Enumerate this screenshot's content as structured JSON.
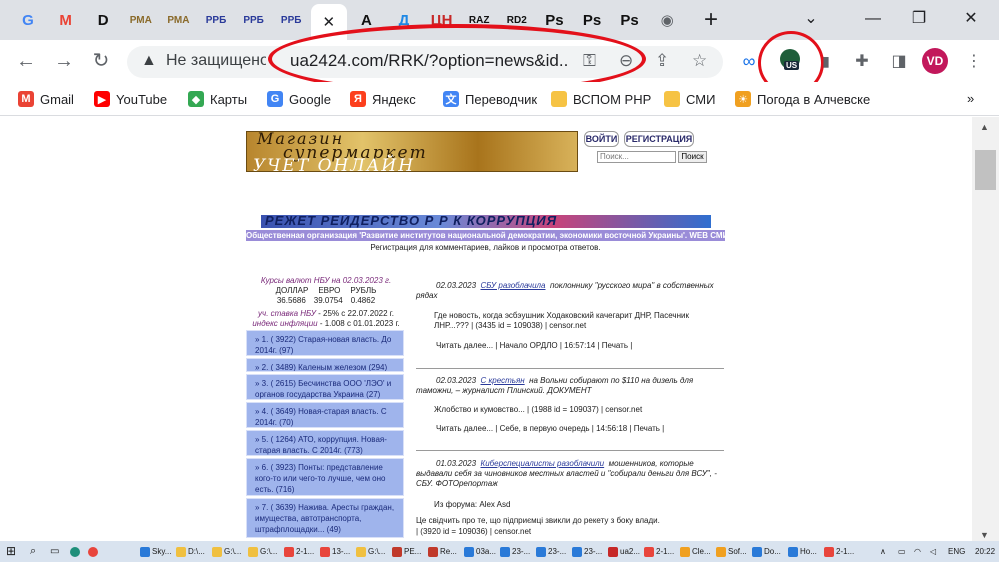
{
  "browser": {
    "tabs": [
      {
        "label": "G",
        "icon": "google-icon",
        "color": "#4285f4"
      },
      {
        "label": "M",
        "icon": "gmail-icon",
        "color": "#ea4335"
      },
      {
        "label": "D",
        "icon": "d-icon",
        "color": "#111111"
      },
      {
        "label": "РМА",
        "icon": "pma-icon",
        "color": "#8a6a2a"
      },
      {
        "label": "РМА",
        "icon": "pma-icon",
        "color": "#8a6a2a"
      },
      {
        "label": "РРБ",
        "icon": "rrb-icon",
        "color": "#2a3a9a"
      },
      {
        "label": "РРБ",
        "icon": "rrb-icon",
        "color": "#2a3a9a"
      },
      {
        "label": "РРБ",
        "icon": "rrb-icon",
        "color": "#2a3a9a"
      },
      {
        "label": "✕",
        "icon": "close-icon",
        "color": "#202124",
        "active": true
      },
      {
        "label": "A",
        "icon": "a-icon",
        "color": "#111111"
      },
      {
        "label": "Д",
        "icon": "d-cyr-icon",
        "color": "#1e88e5"
      },
      {
        "label": "ЦН",
        "icon": "cn-icon",
        "color": "#c62828"
      },
      {
        "label": "RAZ",
        "icon": "raz-icon",
        "color": "#111111"
      },
      {
        "label": "RD2",
        "icon": "rd2-icon",
        "color": "#111111"
      },
      {
        "label": "Ps",
        "icon": "ps-icon",
        "color": "#111111"
      },
      {
        "label": "Ps",
        "icon": "ps-icon",
        "color": "#111111"
      },
      {
        "label": "Ps",
        "icon": "ps-icon",
        "color": "#111111"
      },
      {
        "label": "◉",
        "icon": "globe-icon",
        "color": "#5f6368"
      }
    ],
    "new_tab": "+",
    "window_buttons": {
      "dropdown": "⌄",
      "minimize": "—",
      "restore": "❐",
      "close": "✕"
    },
    "nav": {
      "back": "←",
      "forward": "→",
      "reload": "↻"
    },
    "address": {
      "warning_icon": "▲",
      "status": "Не защищено",
      "url": "ua2424.com/RRK/?option=news&id..."
    },
    "extension_badge": "US",
    "profile_initials": "VD",
    "bookmarks": [
      {
        "label": "Gmail",
        "icon": "gmail-icon",
        "color": "#ea4335",
        "glyph": "M"
      },
      {
        "label": "YouTube",
        "icon": "youtube-icon",
        "color": "#ff0000",
        "glyph": "▶"
      },
      {
        "label": "Карты",
        "icon": "maps-icon",
        "color": "#34a853",
        "glyph": "◆"
      },
      {
        "label": "Google",
        "icon": "google-icon",
        "color": "#4285f4",
        "glyph": "G"
      },
      {
        "label": "Яндекс",
        "icon": "yandex-icon",
        "color": "#fc3f1d",
        "glyph": "Я"
      },
      {
        "label": "Переводчик",
        "icon": "translate-icon",
        "color": "#4285f4",
        "glyph": "文"
      },
      {
        "label": "ВСПОМ PHP",
        "icon": "folder-icon",
        "color": "#f6c344",
        "glyph": ""
      },
      {
        "label": "СМИ",
        "icon": "folder-icon",
        "color": "#f6c344",
        "glyph": ""
      },
      {
        "label": "Погода в Алчевске",
        "icon": "weather-icon",
        "color": "#f0a020",
        "glyph": "☀"
      }
    ],
    "bookmarks_more": "»"
  },
  "site": {
    "banner_lines": [
      "Магазин",
      "супермаркет",
      "УЧЕТ ОНЛАЙН"
    ],
    "login": "ВОЙТИ",
    "register": "РЕГИСТРАЦИЯ",
    "search_placeholder": "Поиск...",
    "search_button": "Поиск",
    "rrk_banner": "РЕЖЕТ РЕЙДЕРСТВО  Р Р К  КОРРУПЦИЯ",
    "org_line": "Общественная организация 'Развитие институтов национальной демократии, экономики восточной Украины'. WEB СМИ",
    "reg_line": "Регистрация для комментариев, лайков и просмотра ответов.",
    "rates": {
      "title": "Курсы валют НБУ на 02.03.2023 г.",
      "headers": [
        "ДОЛЛАР",
        "ЕВРО",
        "РУБЛЬ"
      ],
      "values": [
        "36.5686",
        "39.0754",
        "0.4862"
      ],
      "rate_label": "уч. ставка НБУ",
      "rate_value": "- 25% с 22.07.2022 г.",
      "inflation_label": "индекс инфляции",
      "inflation_value": "- 1.008 с 01.01.2023 г."
    },
    "menu": [
      {
        "text": "» 1. ( 3922) Старая-новая власть. До 2014г. (97)"
      },
      {
        "text": "» 2. ( 3489) Каленым железом (294)"
      },
      {
        "text": "» 3. ( 2615) Бесчинства ООО 'ЛЭО' и органов государства Украина (27)"
      },
      {
        "text": "» 4. ( 3649) Новая-старая власть. С 2014г. (70)"
      },
      {
        "text": "» 5. ( 1264) АТО, коррупция. Новая-старая власть. С 2014г. (773)"
      },
      {
        "text": "» 6. ( 3923) Понты: представление кого-то или чего-то лучше, чем оно есть. (716)"
      },
      {
        "text": "» 7. ( 3639) Нажива. Аресты граждан, имущества, автотранспорта, штрафплощадки... (49)"
      }
    ],
    "news": [
      {
        "date": "02.03.2023",
        "link": "СБУ разоблачила",
        "title": "поклоннику \"русского мира\" в собственных рядах",
        "body": "Где новость, когда эсбэушник Ходаковский качегарит ДНР, Пасечник ЛНР...??? | (3435 id = 109038) | censor.net",
        "meta": "Читать далее... | Начало ОРДЛО | 16:57:14 | Печать |"
      },
      {
        "date": "02.03.2023",
        "link": "С крестьян",
        "title": "на Вольни собирают по $110 на дизель для таможни, – журналист Плинский. ДОКУМЕНТ",
        "body": "Жлобство и кумовство... | (1988 id = 109037) | censor.net",
        "meta": "Читать далее... | Себе, в первую очередь | 14:56:18 | Печать |"
      },
      {
        "date": "01.03.2023",
        "link": "Киберспециалисты разоблачили",
        "title": "мошенников, которые выдавали себя за чиновников местных властей и \"собирали деньги для ВСУ\", - СБУ. ФОТОрепортаж",
        "body": "Из форума: Alex Asd",
        "extra": "Це свідчить про те, що підприємці звикли до рекету з боку влади.",
        "meta": "| (3920 id = 109036) | censor.net"
      }
    ]
  },
  "taskbar": {
    "items": [
      "Sky...",
      "D:\\...",
      "G:\\...",
      "G:\\...",
      "2-1...",
      "13-...",
      "G:\\...",
      "РЕ...",
      "Re...",
      "03а...",
      "23-...",
      "23-...",
      "23-...",
      "ua2...",
      "2-1...",
      "Cle...",
      "Sof...",
      "Do...",
      "Ho...",
      "2-1..."
    ],
    "lang": "ENG",
    "time": "20:22"
  }
}
